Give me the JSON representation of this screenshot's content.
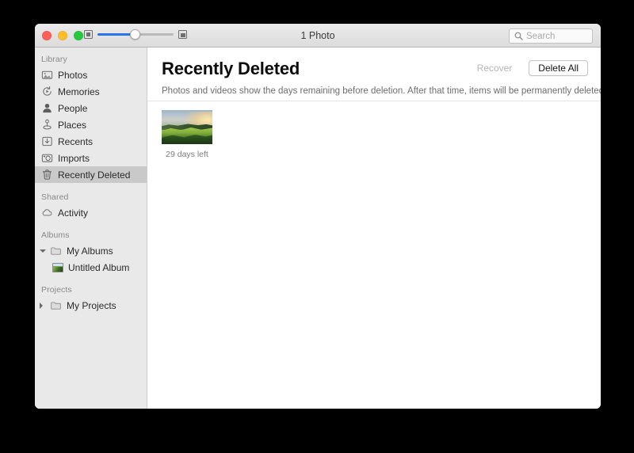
{
  "window": {
    "title": "1 Photo",
    "zoom": {
      "min_icon": "small-thumbnail-icon",
      "max_icon": "large-thumbnail-icon",
      "value_percent": 45
    },
    "traffic_lights": {
      "close": "close-button",
      "minimize": "minimize-button",
      "zoom": "zoom-button"
    }
  },
  "search": {
    "placeholder": "Search",
    "value": ""
  },
  "sidebar": {
    "groups": [
      {
        "title": "Library",
        "items": [
          {
            "label": "Photos",
            "icon": "photos-icon",
            "selected": false
          },
          {
            "label": "Memories",
            "icon": "memories-icon",
            "selected": false
          },
          {
            "label": "People",
            "icon": "people-icon",
            "selected": false
          },
          {
            "label": "Places",
            "icon": "places-pin-icon",
            "selected": false
          },
          {
            "label": "Recents",
            "icon": "recents-download-icon",
            "selected": false
          },
          {
            "label": "Imports",
            "icon": "imports-camera-icon",
            "selected": false
          },
          {
            "label": "Recently Deleted",
            "icon": "trash-icon",
            "selected": true
          }
        ]
      },
      {
        "title": "Shared",
        "items": [
          {
            "label": "Activity",
            "icon": "cloud-icon",
            "selected": false
          }
        ]
      },
      {
        "title": "Albums",
        "items": [
          {
            "label": "My Albums",
            "icon": "folder-icon",
            "selected": false,
            "disclosure": "open"
          },
          {
            "label": "Untitled Album",
            "icon": "album-thumb-icon",
            "selected": false,
            "indent": true
          }
        ]
      },
      {
        "title": "Projects",
        "items": [
          {
            "label": "My Projects",
            "icon": "folder-icon",
            "selected": false,
            "disclosure": "closed"
          }
        ]
      }
    ]
  },
  "main": {
    "title": "Recently Deleted",
    "description": "Photos and videos show the days remaining before deletion. After that time, items will be permanently deleted.",
    "buttons": {
      "recover": {
        "label": "Recover",
        "enabled": false
      },
      "delete_all": {
        "label": "Delete All",
        "enabled": true
      }
    },
    "photos": [
      {
        "caption": "29 days left",
        "alt": "landscape-photo-green-hills-sunset"
      }
    ]
  },
  "colors": {
    "accent_blue": "#2b72f0",
    "sidebar_bg": "#e9e9e9",
    "selection_grey": "#c9c9c9",
    "content_bg": "#ffffff",
    "desktop_bg": "#000000"
  }
}
